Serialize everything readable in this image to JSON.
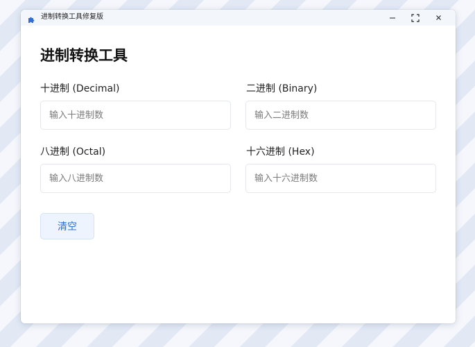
{
  "window": {
    "title": "进制转换工具修复版",
    "accent_color": "#2e6fd1",
    "icons": {
      "app": "puzzle-icon",
      "minimize": "minimize-icon",
      "maximize": "maximize-icon",
      "close": "close-icon"
    }
  },
  "main": {
    "heading": "进制转换工具",
    "fields": {
      "decimal": {
        "label": "十进制 (Decimal)",
        "placeholder": "输入十进制数",
        "value": ""
      },
      "binary": {
        "label": "二进制 (Binary)",
        "placeholder": "输入二进制数",
        "value": ""
      },
      "octal": {
        "label": "八进制 (Octal)",
        "placeholder": "输入八进制数",
        "value": ""
      },
      "hex": {
        "label": "十六进制 (Hex)",
        "placeholder": "输入十六进制数",
        "value": ""
      }
    },
    "clear_button": "清空"
  }
}
